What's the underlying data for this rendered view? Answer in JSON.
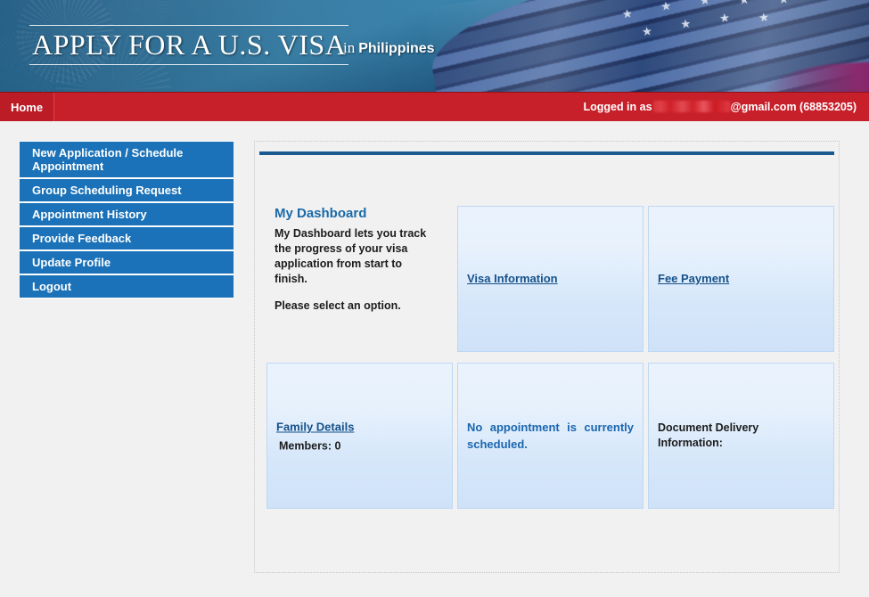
{
  "banner": {
    "wordmark": "APPLY FOR A U.S. VISA",
    "in_word": "in",
    "country": "Philippines"
  },
  "navbar": {
    "home_label": "Home",
    "logged_in_prefix": "Logged in as",
    "email_domain": "@gmail.com",
    "user_id": "(68853205)"
  },
  "sidebar": {
    "items": [
      {
        "label": "New Application / Schedule Appointment"
      },
      {
        "label": "Group Scheduling Request"
      },
      {
        "label": "Appointment History"
      },
      {
        "label": "Provide Feedback"
      },
      {
        "label": "Update Profile"
      },
      {
        "label": "Logout"
      }
    ]
  },
  "dashboard": {
    "title": "My Dashboard",
    "description": "My Dashboard lets you track the progress of your visa application from start to finish.",
    "prompt": "Please select an option."
  },
  "tiles": {
    "visa_information": {
      "link": "Visa Information"
    },
    "fee_payment": {
      "link": "Fee Payment"
    },
    "family_details": {
      "link": "Family Details",
      "members": "Members: 0"
    },
    "appointment": {
      "note": "No appointment is currently scheduled."
    },
    "document_delivery": {
      "text": "Document Delivery Information:"
    }
  },
  "colors": {
    "nav_red": "#c8202b",
    "sidebar_blue": "#1b72b8",
    "rule_blue": "#1b5a91",
    "link_blue": "#16528a",
    "heading_blue": "#1a6aa8",
    "tile_bg_top": "#eaf3fd",
    "tile_bg_bottom": "#cfe2f8",
    "page_bg": "#f1f1f1"
  }
}
